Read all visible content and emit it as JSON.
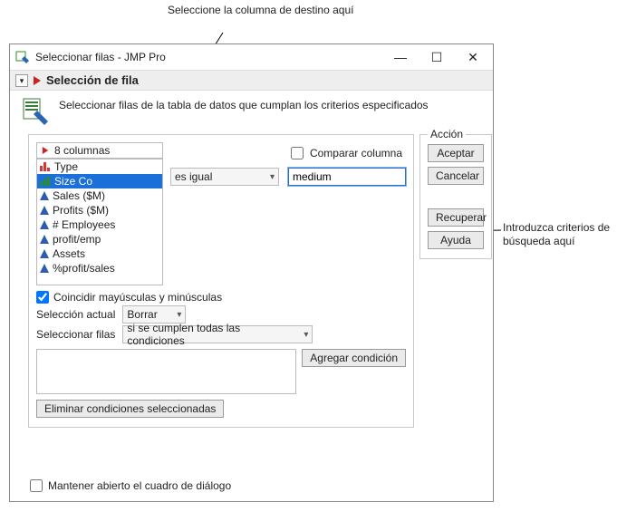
{
  "callouts": {
    "top": "Seleccione la columna de destino aquí",
    "right": "Introduzca criterios de búsqueda aquí"
  },
  "window": {
    "title": "Seleccionar filas - JMP Pro"
  },
  "header": {
    "title": "Selección de fila"
  },
  "description": "Seleccionar filas de la tabla de datos que cumplan los criterios especificados",
  "columns": {
    "count_label": "8 columnas",
    "items": [
      {
        "label": "Type"
      },
      {
        "label": "Size Co"
      },
      {
        "label": "Sales ($M)"
      },
      {
        "label": "Profits ($M)"
      },
      {
        "label": "# Employees"
      },
      {
        "label": "profit/emp"
      },
      {
        "label": "Assets"
      },
      {
        "label": "%profit/sales"
      }
    ]
  },
  "criteria": {
    "compare_label": "Comparar columna",
    "operator": "es igual",
    "value": "medium"
  },
  "match_case_label": "Coincidir mayúsculas y minúsculas",
  "current_selection": {
    "label": "Selección actual",
    "value": "Borrar"
  },
  "select_rows": {
    "label": "Seleccionar filas",
    "value": "si se cumplen todas las condiciones"
  },
  "buttons": {
    "add_condition": "Agregar condición",
    "remove_conditions": "Eliminar condiciones seleccionadas"
  },
  "actions": {
    "legend": "Acción",
    "accept": "Aceptar",
    "cancel": "Cancelar",
    "recover": "Recuperar",
    "help": "Ayuda"
  },
  "keep_open_label": "Mantener abierto el cuadro de diálogo"
}
